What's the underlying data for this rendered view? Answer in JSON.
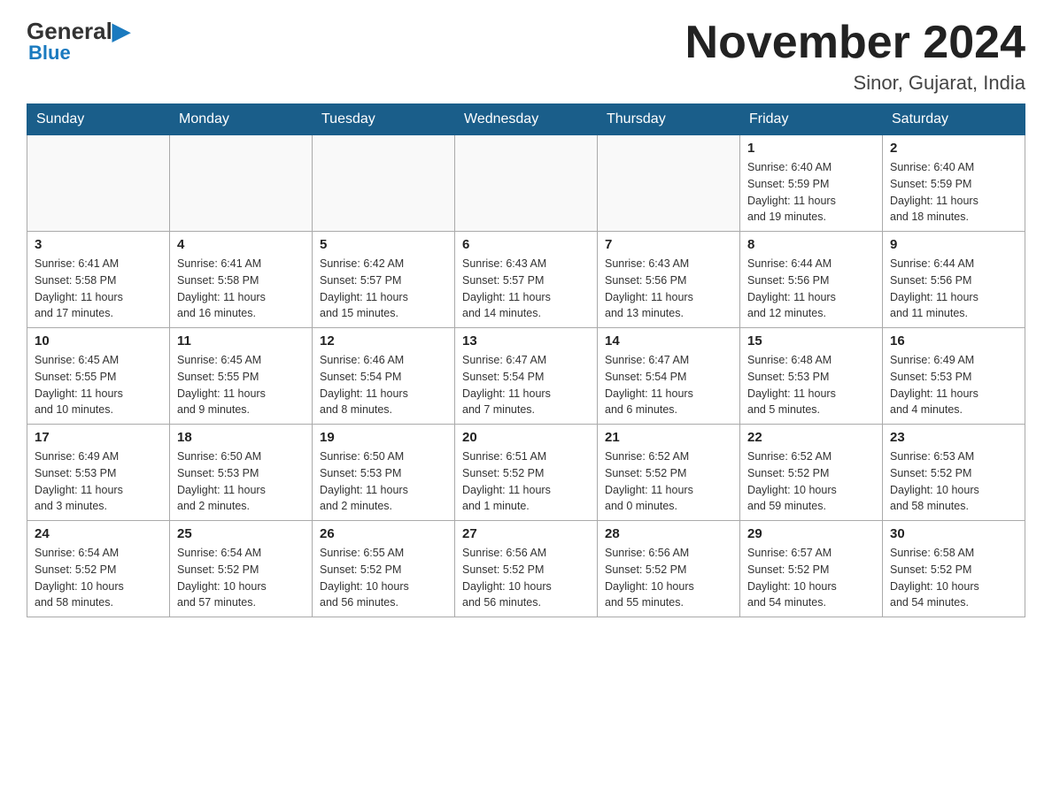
{
  "logo": {
    "general": "General",
    "blue": "Blue"
  },
  "title": "November 2024",
  "subtitle": "Sinor, Gujarat, India",
  "days_of_week": [
    "Sunday",
    "Monday",
    "Tuesday",
    "Wednesday",
    "Thursday",
    "Friday",
    "Saturday"
  ],
  "weeks": [
    [
      {
        "day": "",
        "info": ""
      },
      {
        "day": "",
        "info": ""
      },
      {
        "day": "",
        "info": ""
      },
      {
        "day": "",
        "info": ""
      },
      {
        "day": "",
        "info": ""
      },
      {
        "day": "1",
        "info": "Sunrise: 6:40 AM\nSunset: 5:59 PM\nDaylight: 11 hours\nand 19 minutes."
      },
      {
        "day": "2",
        "info": "Sunrise: 6:40 AM\nSunset: 5:59 PM\nDaylight: 11 hours\nand 18 minutes."
      }
    ],
    [
      {
        "day": "3",
        "info": "Sunrise: 6:41 AM\nSunset: 5:58 PM\nDaylight: 11 hours\nand 17 minutes."
      },
      {
        "day": "4",
        "info": "Sunrise: 6:41 AM\nSunset: 5:58 PM\nDaylight: 11 hours\nand 16 minutes."
      },
      {
        "day": "5",
        "info": "Sunrise: 6:42 AM\nSunset: 5:57 PM\nDaylight: 11 hours\nand 15 minutes."
      },
      {
        "day": "6",
        "info": "Sunrise: 6:43 AM\nSunset: 5:57 PM\nDaylight: 11 hours\nand 14 minutes."
      },
      {
        "day": "7",
        "info": "Sunrise: 6:43 AM\nSunset: 5:56 PM\nDaylight: 11 hours\nand 13 minutes."
      },
      {
        "day": "8",
        "info": "Sunrise: 6:44 AM\nSunset: 5:56 PM\nDaylight: 11 hours\nand 12 minutes."
      },
      {
        "day": "9",
        "info": "Sunrise: 6:44 AM\nSunset: 5:56 PM\nDaylight: 11 hours\nand 11 minutes."
      }
    ],
    [
      {
        "day": "10",
        "info": "Sunrise: 6:45 AM\nSunset: 5:55 PM\nDaylight: 11 hours\nand 10 minutes."
      },
      {
        "day": "11",
        "info": "Sunrise: 6:45 AM\nSunset: 5:55 PM\nDaylight: 11 hours\nand 9 minutes."
      },
      {
        "day": "12",
        "info": "Sunrise: 6:46 AM\nSunset: 5:54 PM\nDaylight: 11 hours\nand 8 minutes."
      },
      {
        "day": "13",
        "info": "Sunrise: 6:47 AM\nSunset: 5:54 PM\nDaylight: 11 hours\nand 7 minutes."
      },
      {
        "day": "14",
        "info": "Sunrise: 6:47 AM\nSunset: 5:54 PM\nDaylight: 11 hours\nand 6 minutes."
      },
      {
        "day": "15",
        "info": "Sunrise: 6:48 AM\nSunset: 5:53 PM\nDaylight: 11 hours\nand 5 minutes."
      },
      {
        "day": "16",
        "info": "Sunrise: 6:49 AM\nSunset: 5:53 PM\nDaylight: 11 hours\nand 4 minutes."
      }
    ],
    [
      {
        "day": "17",
        "info": "Sunrise: 6:49 AM\nSunset: 5:53 PM\nDaylight: 11 hours\nand 3 minutes."
      },
      {
        "day": "18",
        "info": "Sunrise: 6:50 AM\nSunset: 5:53 PM\nDaylight: 11 hours\nand 2 minutes."
      },
      {
        "day": "19",
        "info": "Sunrise: 6:50 AM\nSunset: 5:53 PM\nDaylight: 11 hours\nand 2 minutes."
      },
      {
        "day": "20",
        "info": "Sunrise: 6:51 AM\nSunset: 5:52 PM\nDaylight: 11 hours\nand 1 minute."
      },
      {
        "day": "21",
        "info": "Sunrise: 6:52 AM\nSunset: 5:52 PM\nDaylight: 11 hours\nand 0 minutes."
      },
      {
        "day": "22",
        "info": "Sunrise: 6:52 AM\nSunset: 5:52 PM\nDaylight: 10 hours\nand 59 minutes."
      },
      {
        "day": "23",
        "info": "Sunrise: 6:53 AM\nSunset: 5:52 PM\nDaylight: 10 hours\nand 58 minutes."
      }
    ],
    [
      {
        "day": "24",
        "info": "Sunrise: 6:54 AM\nSunset: 5:52 PM\nDaylight: 10 hours\nand 58 minutes."
      },
      {
        "day": "25",
        "info": "Sunrise: 6:54 AM\nSunset: 5:52 PM\nDaylight: 10 hours\nand 57 minutes."
      },
      {
        "day": "26",
        "info": "Sunrise: 6:55 AM\nSunset: 5:52 PM\nDaylight: 10 hours\nand 56 minutes."
      },
      {
        "day": "27",
        "info": "Sunrise: 6:56 AM\nSunset: 5:52 PM\nDaylight: 10 hours\nand 56 minutes."
      },
      {
        "day": "28",
        "info": "Sunrise: 6:56 AM\nSunset: 5:52 PM\nDaylight: 10 hours\nand 55 minutes."
      },
      {
        "day": "29",
        "info": "Sunrise: 6:57 AM\nSunset: 5:52 PM\nDaylight: 10 hours\nand 54 minutes."
      },
      {
        "day": "30",
        "info": "Sunrise: 6:58 AM\nSunset: 5:52 PM\nDaylight: 10 hours\nand 54 minutes."
      }
    ]
  ]
}
